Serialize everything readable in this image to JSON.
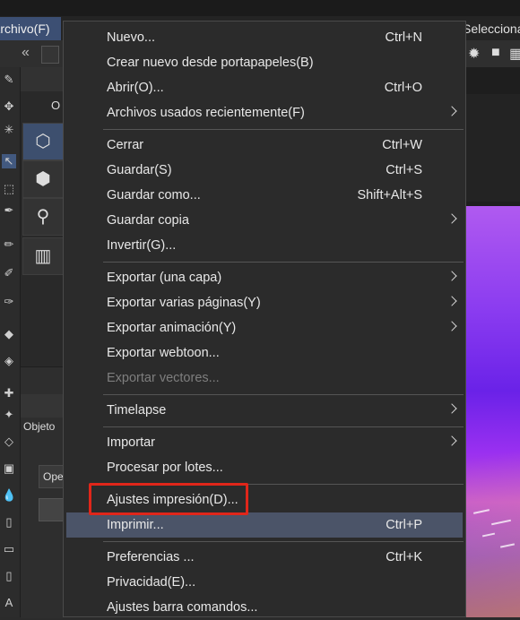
{
  "menubar": {
    "archivo_label": "Archivo(F)",
    "seleccionar_label": "Seleccionar"
  },
  "side_panel": {
    "tab_label": "O",
    "objeto_label": "Objeto",
    "ope_label": "Ope"
  },
  "file_menu": {
    "items": [
      {
        "label": "Nuevo...",
        "shortcut": "Ctrl+N"
      },
      {
        "label": "Crear nuevo desde portapapeles(B)",
        "shortcut": ""
      },
      {
        "label": "Abrir(O)...",
        "shortcut": "Ctrl+O"
      },
      {
        "label": "Archivos usados recientemente(F)",
        "shortcut": "",
        "submenu": true
      },
      {
        "label": "Cerrar",
        "shortcut": "Ctrl+W"
      },
      {
        "label": "Guardar(S)",
        "shortcut": "Ctrl+S"
      },
      {
        "label": "Guardar como...",
        "shortcut": "Shift+Alt+S"
      },
      {
        "label": "Guardar copia",
        "shortcut": "",
        "submenu": true
      },
      {
        "label": "Invertir(G)...",
        "shortcut": ""
      },
      {
        "label": "Exportar (una capa)",
        "shortcut": "",
        "submenu": true
      },
      {
        "label": "Exportar varias páginas(Y)",
        "shortcut": "",
        "submenu": true
      },
      {
        "label": "Exportar animación(Y)",
        "shortcut": "",
        "submenu": true
      },
      {
        "label": "Exportar webtoon...",
        "shortcut": ""
      },
      {
        "label": "Exportar vectores...",
        "shortcut": "",
        "disabled": true
      },
      {
        "label": "Timelapse",
        "shortcut": "",
        "submenu": true
      },
      {
        "label": "Importar",
        "shortcut": "",
        "submenu": true
      },
      {
        "label": "Procesar por lotes...",
        "shortcut": ""
      },
      {
        "label": "Ajustes impresión(D)...",
        "shortcut": "",
        "annotated": true
      },
      {
        "label": "Imprimir...",
        "shortcut": "Ctrl+P",
        "highlighted": true
      },
      {
        "label": "Preferencias ...",
        "shortcut": "Ctrl+K"
      },
      {
        "label": "Privacidad(E)...",
        "shortcut": ""
      },
      {
        "label": "Ajustes barra comandos...",
        "shortcut": ""
      }
    ]
  },
  "colors": {
    "menu_bg": "#2b2b2b",
    "highlight": "#4b5468",
    "annotation_box": "#e0261a",
    "menubar_active": "#3c4f73"
  }
}
